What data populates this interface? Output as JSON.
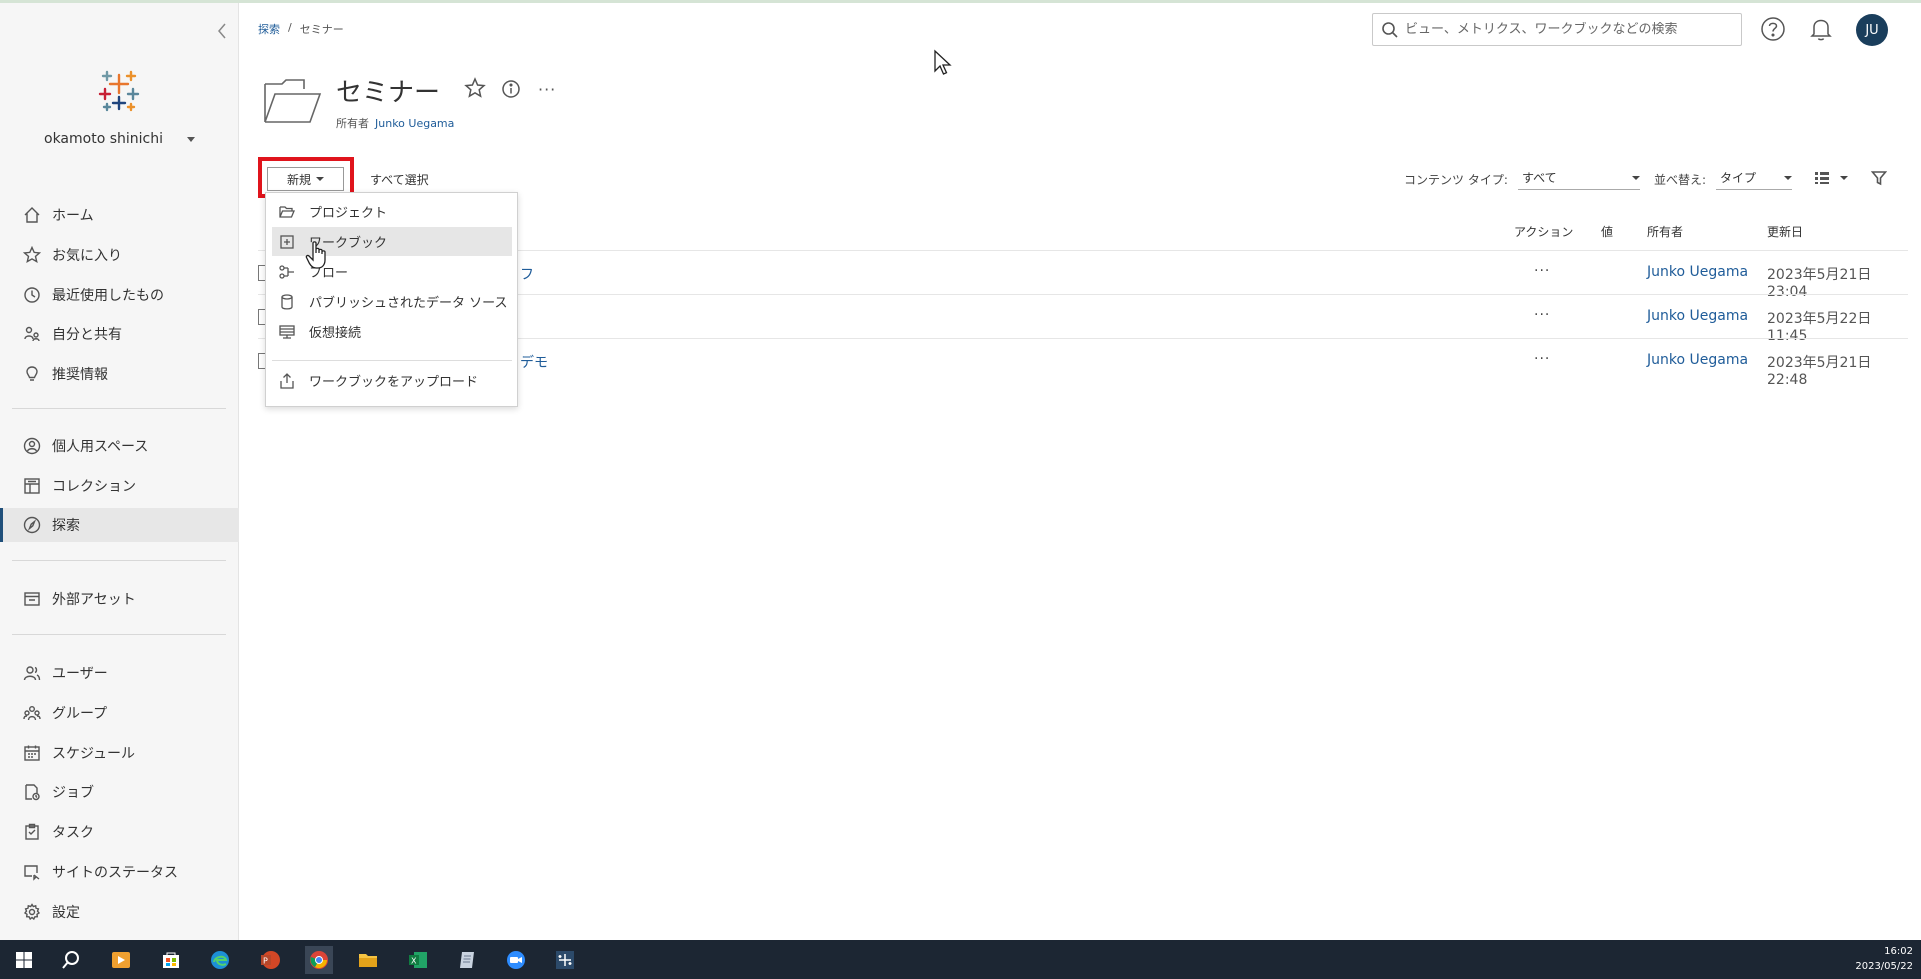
{
  "sidebar": {
    "user_name": "okamoto shinichi",
    "items": [
      {
        "label": "ホーム",
        "icon": "home-icon"
      },
      {
        "label": "お気に入り",
        "icon": "star-icon"
      },
      {
        "label": "最近使用したもの",
        "icon": "clock-icon"
      },
      {
        "label": "自分と共有",
        "icon": "share-icon"
      },
      {
        "label": "推奨情報",
        "icon": "lightbulb-icon"
      },
      {
        "label": "個人用スペース",
        "icon": "person-icon"
      },
      {
        "label": "コレクション",
        "icon": "collection-icon"
      },
      {
        "label": "探索",
        "icon": "compass-icon"
      },
      {
        "label": "外部アセット",
        "icon": "external-assets-icon"
      },
      {
        "label": "ユーザー",
        "icon": "user-icon"
      },
      {
        "label": "グループ",
        "icon": "group-icon"
      },
      {
        "label": "スケジュール",
        "icon": "calendar-icon"
      },
      {
        "label": "ジョブ",
        "icon": "job-icon"
      },
      {
        "label": "タスク",
        "icon": "task-icon"
      },
      {
        "label": "サイトのステータス",
        "icon": "status-icon"
      },
      {
        "label": "設定",
        "icon": "gear-icon"
      }
    ]
  },
  "header": {
    "breadcrumb": [
      "探索",
      "/",
      "セミナー"
    ],
    "search_placeholder": "ビュー、メトリクス、ワークブックなどの検索",
    "avatar_initials": "JU"
  },
  "page": {
    "title": "セミナー",
    "owner_label": "所有者",
    "owner_name": "Junko Uegama",
    "more": "···"
  },
  "toolbar": {
    "new_label": "新規",
    "select_all": "すべて選択",
    "content_type_label": "コンテンツ タイプ:",
    "content_type_value": "すべて",
    "sort_label": "並べ替え:",
    "sort_value": "タイプ"
  },
  "table": {
    "columns": [
      "アクション",
      "値",
      "所有者",
      "更新日"
    ],
    "rows": [
      {
        "name_suffix": "フ",
        "more": "···",
        "owner": "Junko Uegama",
        "date": "2023年5月21日 23:04"
      },
      {
        "name_suffix": "",
        "more": "···",
        "owner": "Junko Uegama",
        "date": "2023年5月22日 11:45"
      },
      {
        "name_suffix": "デモ",
        "more": "···",
        "owner": "Junko Uegama",
        "date": "2023年5月21日 22:48"
      }
    ]
  },
  "new_menu": {
    "items": [
      {
        "label": "プロジェクト",
        "icon": "folder-icon"
      },
      {
        "label": "ワークブック",
        "icon": "workbook-icon"
      },
      {
        "label": "フロー",
        "icon": "flow-icon"
      },
      {
        "label": "パブリッシュされたデータ ソース",
        "icon": "datasource-icon"
      },
      {
        "label": "仮想接続",
        "icon": "virtual-connection-icon"
      },
      {
        "label": "ワークブックをアップロード",
        "icon": "upload-icon"
      }
    ]
  },
  "taskbar": {
    "time": "16:02",
    "date": "2023/05/22"
  },
  "colors": {
    "accent": "#1f5c99",
    "highlight": "#e0141c",
    "taskbar": "#1c2633",
    "avatar": "#1a3e5c"
  }
}
